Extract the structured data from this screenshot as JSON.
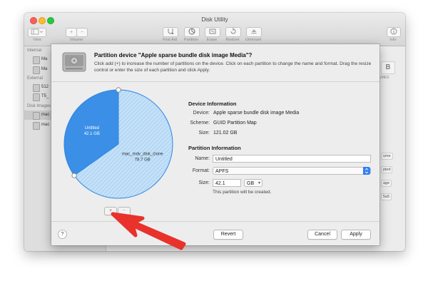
{
  "window": {
    "title": "Disk Utility",
    "toolbar": {
      "view_label": "View",
      "volume_label": "Volume",
      "volume_add": "+",
      "volume_remove": "−",
      "first_aid_label": "First Aid",
      "partition_label": "Partition",
      "erase_label": "Erase",
      "restore_label": "Restore",
      "unmount_label": "Unmount",
      "info_label": "Info"
    }
  },
  "sidebar": {
    "sections": [
      {
        "heading": "Internal",
        "items": [
          "Ma",
          "Ma"
        ]
      },
      {
        "heading": "External",
        "items": [
          "512",
          "T5_"
        ]
      },
      {
        "heading": "Disk Images",
        "items": [
          "mac",
          "mac"
        ]
      }
    ]
  },
  "right_panel": {
    "chips": [
      "ume",
      "pled",
      "age",
      "5a5"
    ],
    "gb_fragment": "B",
    "umes_fragment": "UMES"
  },
  "sheet": {
    "title": "Partition device \"Apple sparse bundle disk image Media\"?",
    "description": "Click add (+) to increase the number of partitions on the device. Click on each partition to change the name and format. Drag the resize control or enter the size of each partition and click Apply.",
    "pie": {
      "partitions": [
        {
          "name": "Untitled",
          "size": "42.1 GB",
          "value": 42.1,
          "color": "#3b8fe6"
        },
        {
          "name": "mac_mdv_disk_clone",
          "size": "78.7 GB",
          "value": 78.7,
          "color": "#b9dbf6"
        }
      ],
      "add_label": "+",
      "remove_label": "−"
    },
    "device_info": {
      "heading": "Device Information",
      "device_label": "Device:",
      "device_value": "Apple sparse bundle disk image Media",
      "scheme_label": "Scheme:",
      "scheme_value": "GUID Partition Map",
      "size_label": "Size:",
      "size_value": "121.02 GB"
    },
    "partition_info": {
      "heading": "Partition Information",
      "name_label": "Name:",
      "name_value": "Untitled",
      "format_label": "Format:",
      "format_value": "APFS",
      "size_label": "Size:",
      "size_value": "42.1",
      "size_unit": "GB",
      "note": "This partition will be created."
    },
    "buttons": {
      "help": "?",
      "revert": "Revert",
      "cancel": "Cancel",
      "apply": "Apply"
    }
  },
  "annotation": {
    "arrow_color": "#e8322b"
  }
}
